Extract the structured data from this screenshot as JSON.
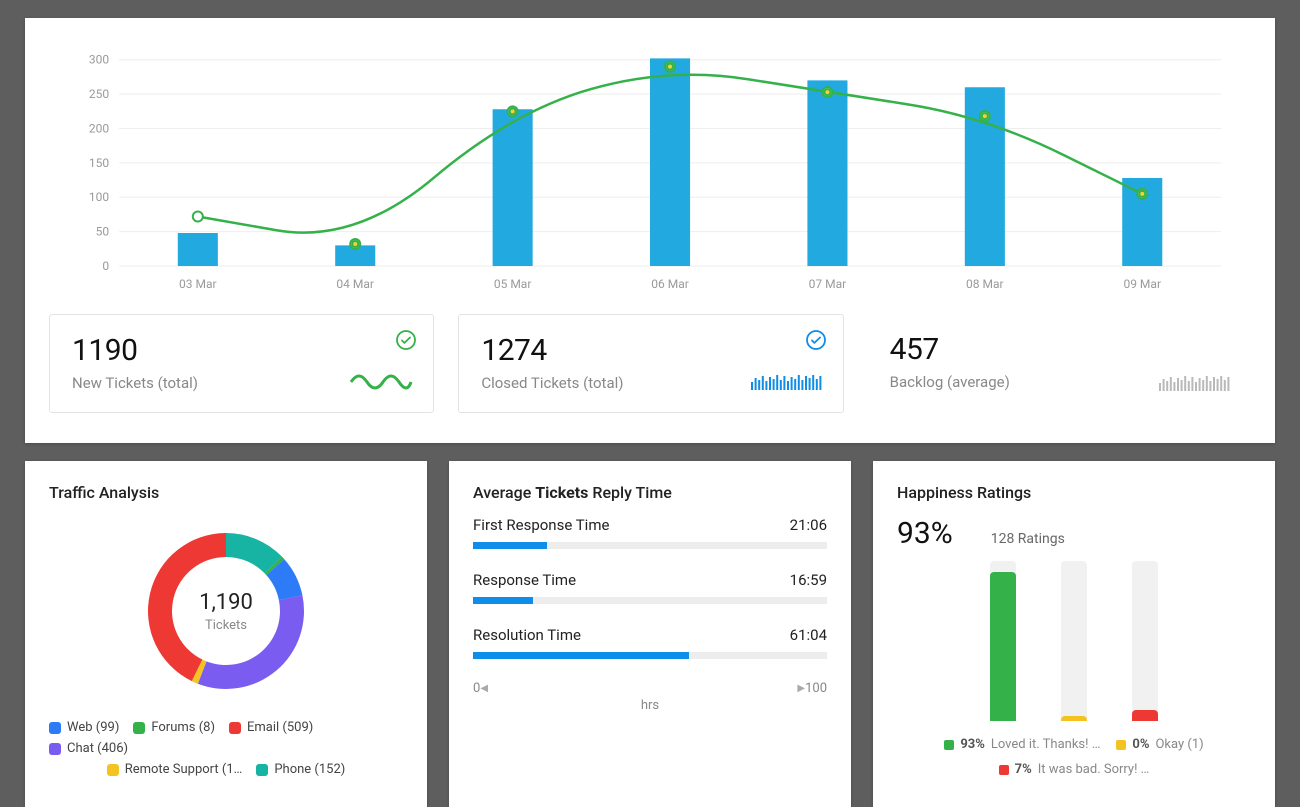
{
  "colors": {
    "bar": "#22a9e0",
    "line": "#35b14a",
    "blue": "#0e8ee9",
    "grey": "#b9b9b9",
    "green": "#35b14a",
    "yellow": "#f4d03f",
    "red": "#ed3833"
  },
  "chart_data": {
    "type": "bar+line",
    "categories": [
      "03 Mar",
      "04 Mar",
      "05 Mar",
      "06 Mar",
      "07 Mar",
      "08 Mar",
      "09 Mar"
    ],
    "y_ticks": [
      0,
      50,
      100,
      150,
      200,
      250,
      300
    ],
    "ylim": [
      0,
      320
    ],
    "series": [
      {
        "name": "New Tickets",
        "kind": "bar",
        "values": [
          48,
          30,
          228,
          302,
          270,
          260,
          128
        ]
      },
      {
        "name": "Closed Tickets",
        "kind": "line",
        "values": [
          72,
          32,
          225,
          290,
          253,
          218,
          105
        ]
      }
    ]
  },
  "kpis": [
    {
      "value": "1190",
      "label": "New Tickets (total)",
      "check": "green",
      "spark": "wave-green"
    },
    {
      "value": "1274",
      "label": "Closed  Tickets (total)",
      "check": "blue",
      "spark": "bars-blue"
    },
    {
      "value": "457",
      "label": "Backlog (average)",
      "check": null,
      "spark": "bars-grey"
    }
  ],
  "traffic": {
    "title": "Traffic Analysis",
    "center_value": "1,190",
    "center_label": "Tickets",
    "slices": [
      {
        "name": "Web",
        "count": 99,
        "color": "#2d7bf6"
      },
      {
        "name": "Forums",
        "count": 8,
        "color": "#35b14a"
      },
      {
        "name": "Email",
        "count": 509,
        "color": "#ed3833"
      },
      {
        "name": "Chat",
        "count": 406,
        "color": "#7b5cf0"
      },
      {
        "name": "Remote Support",
        "count": 16,
        "color": "#f4c321",
        "label_trunc": "Remote Support (1…"
      },
      {
        "name": "Phone",
        "count": 152,
        "color": "#17b3a3"
      }
    ]
  },
  "reply": {
    "title_pre": "Average ",
    "title_bold": "Tickets",
    "title_post": " Reply Time",
    "axis_min": "0",
    "axis_max": "100",
    "unit": "hrs",
    "rows": [
      {
        "label": "First Response Time",
        "value": "21:06",
        "pct": 21
      },
      {
        "label": "Response Time",
        "value": "16:59",
        "pct": 17
      },
      {
        "label": "Resolution Time",
        "value": "61:04",
        "pct": 61
      }
    ]
  },
  "happiness": {
    "title": "Happiness Ratings",
    "percent": "93%",
    "count_label": "128 Ratings",
    "bars": [
      {
        "pct": 93,
        "color": "#35b14a",
        "label": "93%",
        "text": "Loved it. Thanks! …"
      },
      {
        "pct": 0,
        "color": "#f4c321",
        "label": "0%",
        "text": "Okay (1)"
      },
      {
        "pct": 7,
        "color": "#ed3833",
        "label": "7%",
        "text": "It was bad. Sorry! …"
      }
    ]
  }
}
